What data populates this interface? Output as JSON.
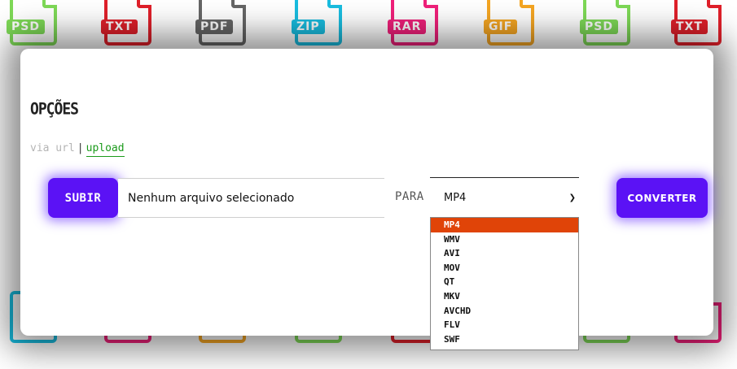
{
  "background_icons": [
    {
      "label": "PSD",
      "color": "#7ed957"
    },
    {
      "label": "TXT",
      "color": "#e0202a"
    },
    {
      "label": "PDF",
      "color": "#666666"
    },
    {
      "label": "ZIP",
      "color": "#19bde0"
    },
    {
      "label": "RAR",
      "color": "#f0207a"
    },
    {
      "label": "GIF",
      "color": "#f5a623"
    },
    {
      "label": "PSD",
      "color": "#7ed957"
    },
    {
      "label": "TXT",
      "color": "#e0202a"
    }
  ],
  "modal": {
    "title": "OPÇÕES",
    "modes": {
      "url": "via url",
      "separator": "|",
      "upload": "upload"
    },
    "upload_button": "SUBIR",
    "file_status": "Nenhum arquivo selecionado",
    "to_label": "PARA",
    "format_select": {
      "selected": "MP4",
      "options": [
        "MP4",
        "WMV",
        "AVI",
        "MOV",
        "QT",
        "MKV",
        "AVCHD",
        "FLV",
        "SWF"
      ]
    },
    "convert_button": "CONVERTER"
  },
  "colors": {
    "accent": "#5b12f5",
    "selected_option": "#e04408",
    "upload_link": "#1a9a1a"
  }
}
